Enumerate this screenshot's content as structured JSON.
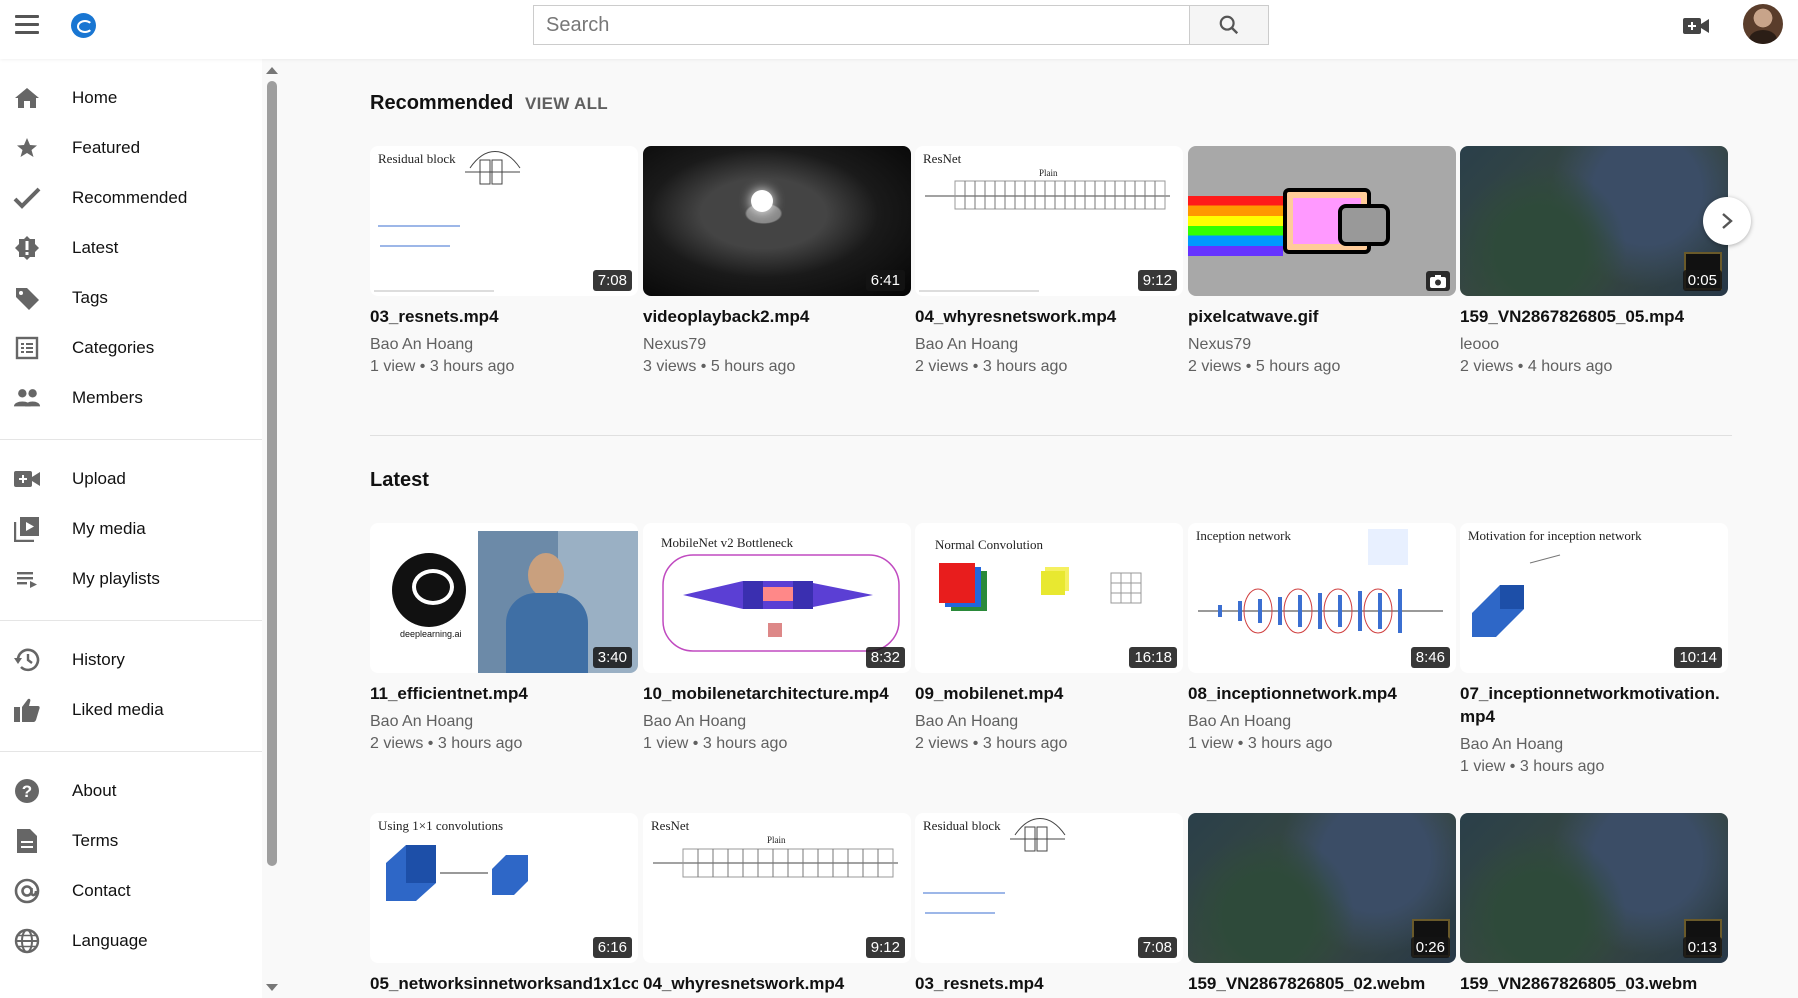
{
  "header": {
    "search_placeholder": "Search"
  },
  "sidebar": {
    "items": [
      {
        "label": "Home",
        "icon": "home-icon"
      },
      {
        "label": "Featured",
        "icon": "star-icon"
      },
      {
        "label": "Recommended",
        "icon": "check-icon"
      },
      {
        "label": "Latest",
        "icon": "alert-badge-icon"
      },
      {
        "label": "Tags",
        "icon": "tag-icon"
      },
      {
        "label": "Categories",
        "icon": "list-icon"
      },
      {
        "label": "Members",
        "icon": "people-icon"
      },
      {
        "label": "Upload",
        "icon": "video-add-icon"
      },
      {
        "label": "My media",
        "icon": "media-library-icon"
      },
      {
        "label": "My playlists",
        "icon": "playlist-icon"
      },
      {
        "label": "History",
        "icon": "history-icon"
      },
      {
        "label": "Liked media",
        "icon": "thumbs-up-icon"
      },
      {
        "label": "About",
        "icon": "help-icon"
      },
      {
        "label": "Terms",
        "icon": "document-icon"
      },
      {
        "label": "Contact",
        "icon": "at-icon"
      },
      {
        "label": "Language",
        "icon": "globe-icon"
      }
    ]
  },
  "recommended": {
    "title": "Recommended",
    "view_all": "VIEW ALL",
    "cards": [
      {
        "title": "03_resnets.mp4",
        "author": "Bao An Hoang",
        "meta": "1 view • 3 hours ago",
        "duration": "7:08",
        "slide_title": "Residual block"
      },
      {
        "title": "videoplayback2.mp4",
        "author": "Nexus79",
        "meta": "3 views • 5 hours ago",
        "duration": "6:41"
      },
      {
        "title": "04_whyresnetswork.mp4",
        "author": "Bao An Hoang",
        "meta": "2 views • 3 hours ago",
        "duration": "9:12",
        "slide_title": "ResNet",
        "slide_sub": "Plain"
      },
      {
        "title": "pixelcatwave.gif",
        "author": "Nexus79",
        "meta": "2 views • 5 hours ago",
        "duration": ""
      },
      {
        "title": "159_VN2867826805_05.mp4",
        "author": "leooo",
        "meta": "2 views • 4 hours ago",
        "duration": "0:05"
      }
    ]
  },
  "latest": {
    "title": "Latest",
    "cards": [
      {
        "title": "11_efficientnet.mp4",
        "author": "Bao An Hoang",
        "meta": "2 views • 3 hours ago",
        "duration": "3:40",
        "logo_text": "deeplearning.ai"
      },
      {
        "title": "10_mobilenetarchitecture.mp4",
        "author": "Bao An Hoang",
        "meta": "1 view • 3 hours ago",
        "duration": "8:32",
        "slide_title": "MobileNet v2 Bottleneck"
      },
      {
        "title": "09_mobilenet.mp4",
        "author": "Bao An Hoang",
        "meta": "2 views • 3 hours ago",
        "duration": "16:18",
        "slide_title": "Normal Convolution"
      },
      {
        "title": "08_inceptionnetwork.mp4",
        "author": "Bao An Hoang",
        "meta": "1 view • 3 hours ago",
        "duration": "8:46",
        "slide_title": "Inception network"
      },
      {
        "title": "07_inceptionnetworkmotivation.mp4",
        "author": "Bao An Hoang",
        "meta": "1 view • 3 hours ago",
        "duration": "10:14",
        "slide_title": "Motivation for inception network"
      },
      {
        "title": "05_networksinnetworksand1x1co",
        "author": "",
        "meta": "",
        "duration": "6:16",
        "slide_title": "Using 1×1 convolutions"
      },
      {
        "title": "04_whyresnetswork.mp4",
        "author": "",
        "meta": "",
        "duration": "9:12",
        "slide_title": "ResNet",
        "slide_sub": "Plain"
      },
      {
        "title": "03_resnets.mp4",
        "author": "",
        "meta": "",
        "duration": "7:08",
        "slide_title": "Residual block"
      },
      {
        "title": "159_VN2867826805_02.webm",
        "author": "",
        "meta": "",
        "duration": "0:26"
      },
      {
        "title": "159_VN2867826805_03.webm",
        "author": "",
        "meta": "",
        "duration": "0:13"
      }
    ]
  }
}
